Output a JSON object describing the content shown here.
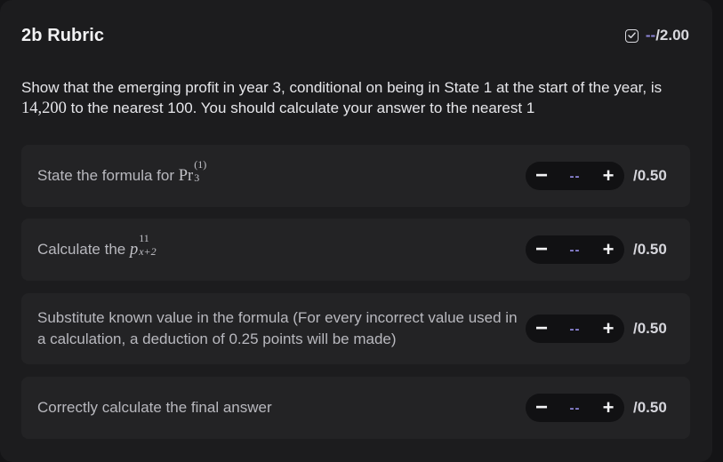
{
  "header": {
    "title": "2b Rubric",
    "score_value": "--",
    "score_total": "/2.00"
  },
  "question": {
    "text_before": "Show that the emerging profit in year 3, conditional on being in State 1 at the start of the year, is",
    "number": "14,200",
    "text_after": " to the nearest 100. You should calculate your answer to the nearest 1"
  },
  "items": [
    {
      "label_prefix": "State the formula for ",
      "math_base": "Pr",
      "math_sup": "(1)",
      "math_sub": "3",
      "value": "--",
      "max": "/0.50"
    },
    {
      "label_prefix": "Calculate the ",
      "math_base": "p",
      "math_sup": "11",
      "math_sub": "x+2",
      "value": "--",
      "max": "/0.50"
    },
    {
      "label": "Substitute known value in the formula (For every incorrect value used in a calculation, a deduction of 0.25 points will be made)",
      "value": "--",
      "max": "/0.50"
    },
    {
      "label": "Correctly calculate the final answer",
      "value": "--",
      "max": "/0.50"
    }
  ],
  "controls": {
    "minus": "−",
    "plus": "+"
  },
  "colors": {
    "background": "#1c1c1e",
    "item_background": "#232325",
    "stepper_background": "#111113",
    "accent": "#8e86d8"
  }
}
